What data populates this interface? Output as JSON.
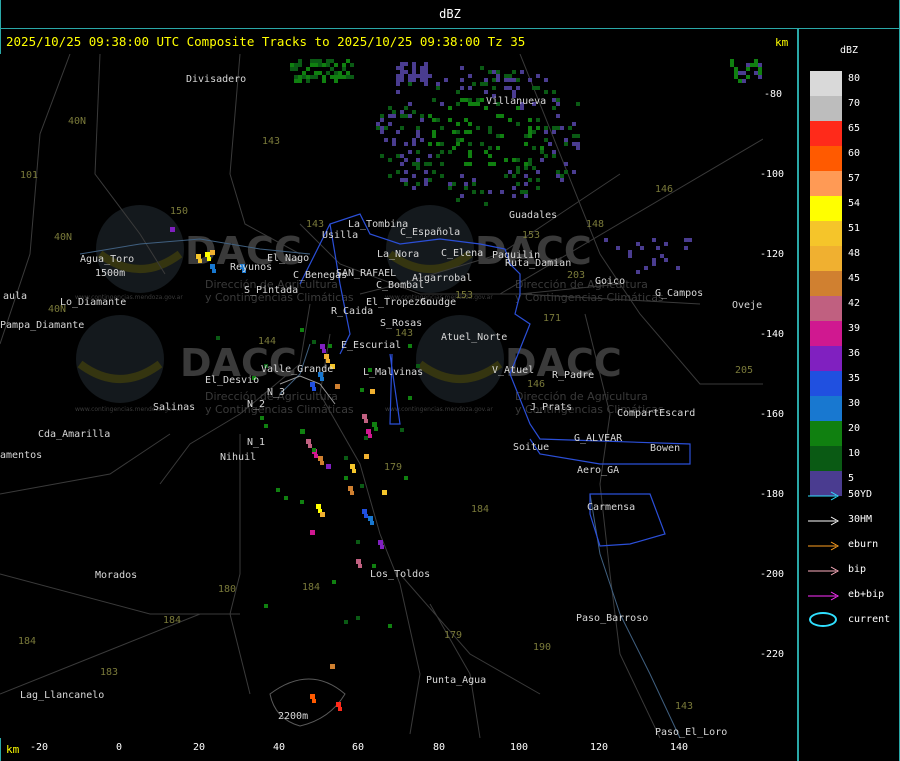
{
  "header": {
    "title": "dBZ"
  },
  "info": {
    "text": "2025/10/25 09:38:00 UTC Composite Tracks to 2025/10/25 09:38:00 Tz 35",
    "km_right": "km",
    "km_bottom": "km"
  },
  "legend": {
    "title": "dBZ",
    "levels": [
      {
        "label": "80",
        "color": "#d9d9d9"
      },
      {
        "label": "70",
        "color": "#bdbdbd"
      },
      {
        "label": "65",
        "color": "#ff2a1a"
      },
      {
        "label": "60",
        "color": "#ff5a00"
      },
      {
        "label": "57",
        "color": "#ff9a55"
      },
      {
        "label": "54",
        "color": "#ffff00"
      },
      {
        "label": "51",
        "color": "#f5c52a"
      },
      {
        "label": "48",
        "color": "#f0b030"
      },
      {
        "label": "45",
        "color": "#d08030"
      },
      {
        "label": "42",
        "color": "#c06080"
      },
      {
        "label": "39",
        "color": "#d01890"
      },
      {
        "label": "36",
        "color": "#8020c0"
      },
      {
        "label": "35",
        "color": "#2050e0"
      },
      {
        "label": "30",
        "color": "#1878d0"
      },
      {
        "label": "20",
        "color": "#108010"
      },
      {
        "label": "10",
        "color": "#0a5a14"
      },
      {
        "label": "5",
        "color": "#4a3c90"
      }
    ],
    "tracks": [
      {
        "label": "50YD",
        "color": "#30e0ff"
      },
      {
        "label": "30HM",
        "color": "#ffffff"
      },
      {
        "label": "eburn",
        "color": "#ffa020"
      },
      {
        "label": "bip",
        "color": "#ffb0c0"
      },
      {
        "label": "eb+bip",
        "color": "#ff30ff"
      },
      {
        "label": "current",
        "color": "#30e0ff"
      }
    ]
  },
  "axes": {
    "x_ticks": [
      "-20",
      "0",
      "20",
      "40",
      "60",
      "80",
      "100",
      "120",
      "140"
    ],
    "y_ticks": [
      "-80",
      "-100",
      "-120",
      "-140",
      "-160",
      "-180",
      "-200",
      "-220"
    ]
  },
  "places": [
    "Divisadero",
    "Villanueva",
    "Guadales",
    "La_Tombina",
    "Usilla",
    "C_Española",
    "C_Elena",
    "Paquilin",
    "Ruta_Damian",
    "Agua_Toro",
    "Reyunos",
    "El_Nago",
    "C_Benegas",
    "SAN_RAFAEL",
    "La_Nora",
    "Algarrobal",
    "C_Bombal",
    "El_Tropezon",
    "Goudge",
    "S_Pintada",
    "R_Caida",
    "S_Rosas",
    "Atuel_Norte",
    "E_Escurial",
    "Valle_Grande",
    "L_Malvinas",
    "V_Atuel",
    "R_Padre",
    "El_Desvio",
    "Salinas",
    "N_2",
    "N_3",
    "N_1",
    "Nihuil",
    "J_Prats",
    "CompartEscard",
    "G_ALVEAR",
    "Bowen",
    "Soitue",
    "Aero_GA",
    "Carmensa",
    "Cda_Amarilla",
    "amentos",
    "Los_Toldos",
    "Morados",
    "Paso_Barroso",
    "Punta_Agua",
    "Lag_Llancanelo",
    "Paso_El_Loro",
    "Goico",
    "G_Campos",
    "Ovejer",
    "aula",
    "Pampa_Diamante",
    "Lo_Diamante",
    "1500m",
    "2200m"
  ],
  "route_numbers": [
    "40N",
    "101",
    "143",
    "150",
    "40N",
    "40N",
    "144",
    "143",
    "146",
    "148",
    "153",
    "153",
    "203",
    "171",
    "143",
    "179",
    "184",
    "184",
    "180",
    "184",
    "179",
    "190",
    "183",
    "184",
    "143",
    "205",
    "146"
  ],
  "watermark": {
    "brand": "DACC",
    "sub1": "Dirección de Agricultura",
    "sub2": "y Contingencias Climáticas",
    "url": "www.contingencias.mendoza.gov.ar"
  }
}
